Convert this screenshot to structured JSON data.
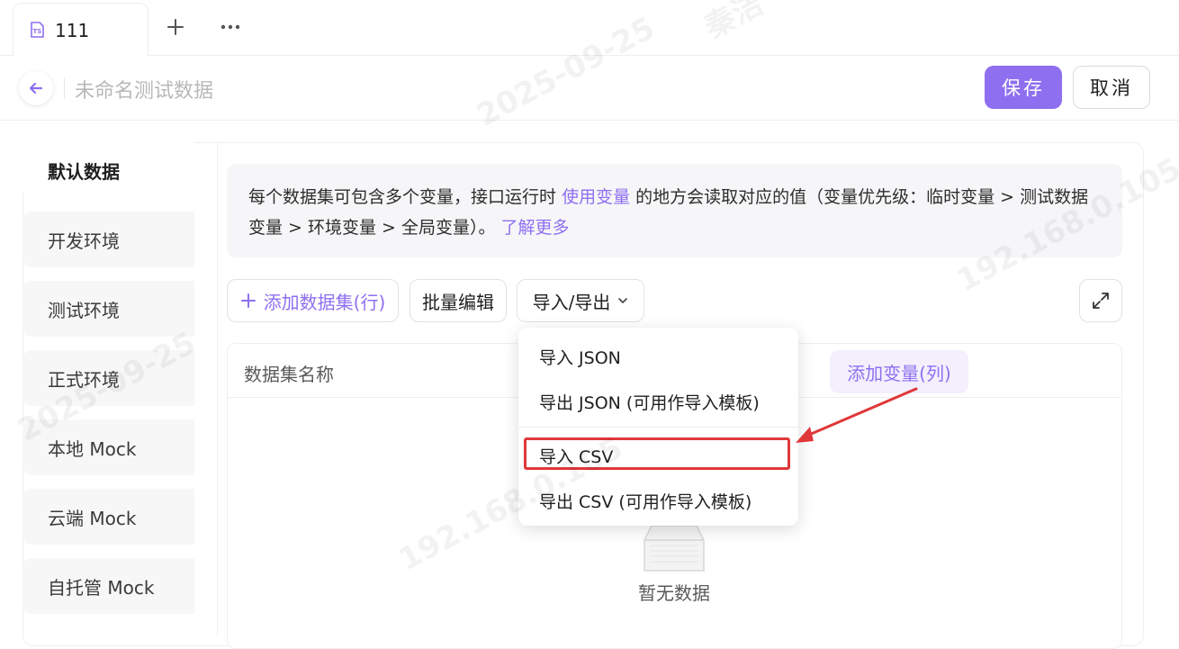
{
  "tabs": [
    {
      "label": "111",
      "icon": "ts-file-icon"
    }
  ],
  "tabbar": {
    "add_icon": "plus-icon",
    "more_icon": "more-icon"
  },
  "header": {
    "title_placeholder": "未命名测试数据",
    "save_label": "保存",
    "cancel_label": "取消"
  },
  "sidebar": {
    "items": [
      {
        "label": "默认数据",
        "active": true
      },
      {
        "label": "开发环境"
      },
      {
        "label": "测试环境"
      },
      {
        "label": "正式环境"
      },
      {
        "label": "本地 Mock"
      },
      {
        "label": "云端 Mock"
      },
      {
        "label": "自托管 Mock"
      }
    ]
  },
  "info": {
    "text_before": "每个数据集可包含多个变量，接口运行时",
    "link_variable": "使用变量",
    "text_middle": "的地方会读取对应的值（变量优先级：临时变量 > 测试数据变量 > 环境变量 > 全局变量）。",
    "link_learn": "了解更多"
  },
  "toolbar": {
    "add_dataset": "添加数据集(行)",
    "batch_edit": "批量编辑",
    "import_export": "导入/导出"
  },
  "table": {
    "col_name": "数据集名称",
    "add_variable": "添加变量(列)",
    "empty_text": "暂无数据"
  },
  "dropdown": {
    "items": [
      "导入 JSON",
      "导出 JSON (可用作导入模板)",
      "导入 CSV",
      "导出 CSV (可用作导入模板)"
    ]
  },
  "watermark": {
    "name": "秦洁",
    "date": "2025-09-25",
    "ip": "192.168.0.105"
  },
  "colors": {
    "accent": "#8e6ff0",
    "annotation": "#e0373a"
  }
}
